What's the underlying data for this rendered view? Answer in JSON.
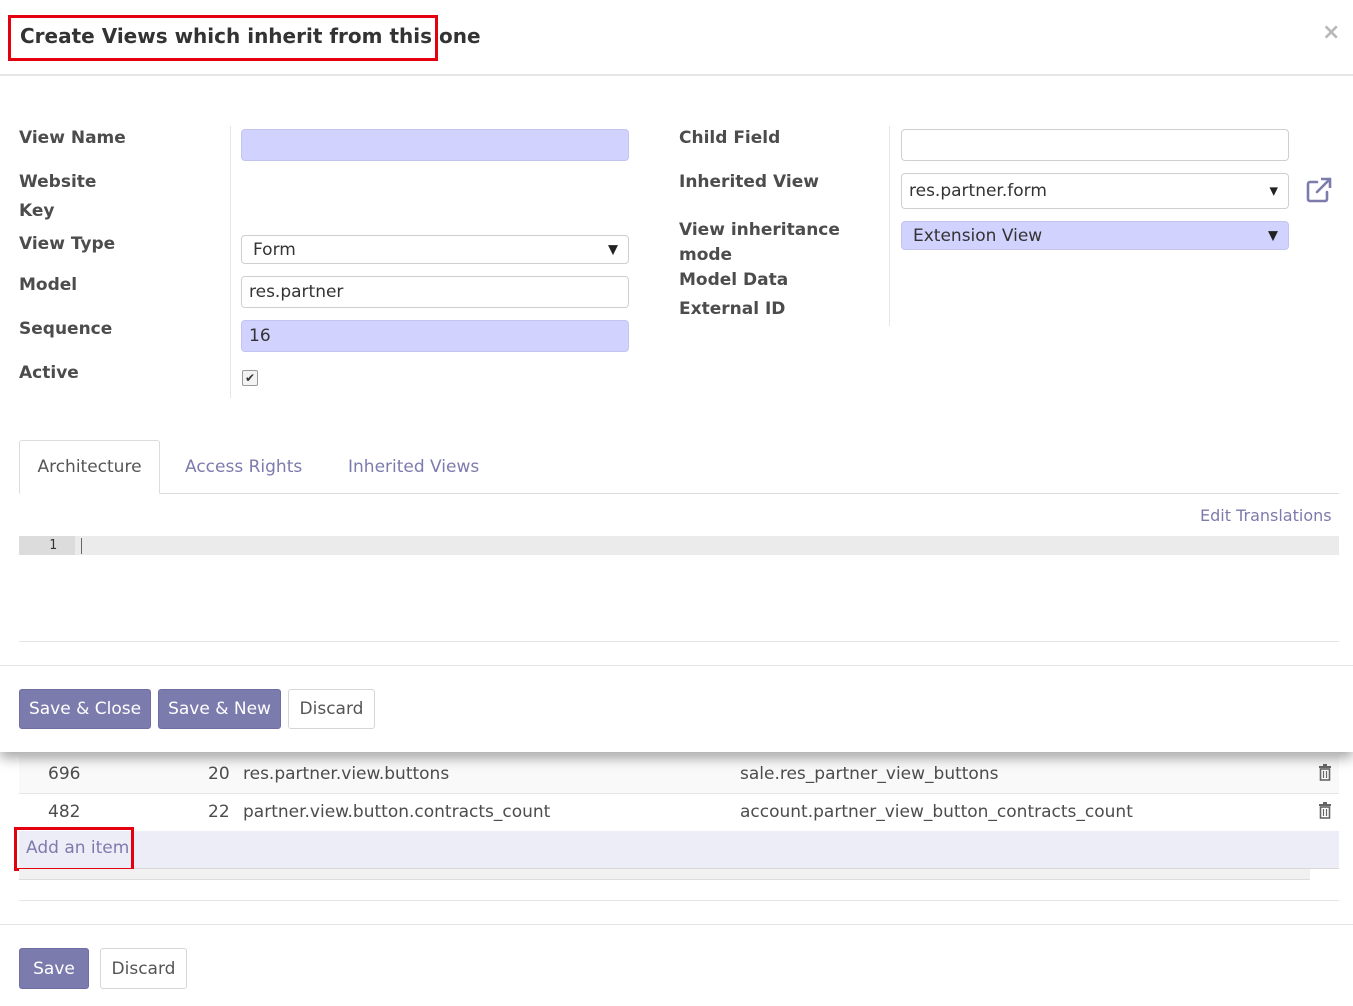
{
  "background": {
    "rows": [
      {
        "id": "696",
        "sequence": "20",
        "name": "res.partner.view.buttons",
        "xml_id": "sale.res_partner_view_buttons"
      },
      {
        "id": "482",
        "sequence": "22",
        "name": "partner.view.button.contracts_count",
        "xml_id": "account.partner_view_button_contracts_count"
      }
    ],
    "add_item_label": "Add an item",
    "save_label": "Save",
    "discard_label": "Discard"
  },
  "modal": {
    "title": "Create Views which inherit from this one",
    "close_label": "×",
    "left_labels": {
      "view_name": "View Name",
      "website": "Website",
      "key": "Key",
      "view_type": "View Type",
      "model": "Model",
      "sequence": "Sequence",
      "active": "Active"
    },
    "right_labels": {
      "child_field": "Child Field",
      "inherited_view": "Inherited View",
      "view_inheritance": "View inheritance",
      "mode": "mode",
      "model_data": "Model Data",
      "external_id": "External ID"
    },
    "values": {
      "view_name": "",
      "view_type": "Form",
      "model": "res.partner",
      "sequence": "16",
      "active_check": "✔",
      "child_field": "",
      "inherited_view": "res.partner.form",
      "inheritance_mode": "Extension View"
    },
    "tabs": [
      "Architecture",
      "Access Rights",
      "Inherited Views"
    ],
    "edit_translations": "Edit Translations",
    "editor_line": "1",
    "buttons": {
      "save_close": "Save & Close",
      "save_new": "Save & New",
      "discard": "Discard"
    }
  },
  "colors": {
    "brand": "#7c7bad",
    "required_field": "#d2d2ff",
    "highlight_box": "#e4000f"
  }
}
